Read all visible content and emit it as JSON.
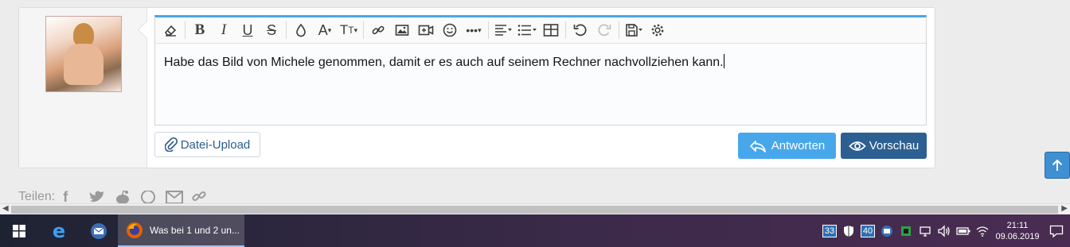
{
  "editor": {
    "text": "Habe das Bild von Michele genommen, damit er es auch auf seinem Rechner nachvollziehen kann."
  },
  "toolbar": {
    "buttons": [
      "eraser-icon",
      "bold-icon",
      "italic-icon",
      "underline-icon",
      "strikethrough-icon",
      "text-color-icon",
      "font-family-icon",
      "font-size-icon",
      "link-icon",
      "image-icon",
      "media-icon",
      "emoji-icon",
      "more-icon",
      "align-icon",
      "list-icon",
      "table-icon",
      "undo-icon",
      "redo-icon",
      "drafts-icon",
      "settings-icon"
    ]
  },
  "actions": {
    "upload_label": "Datei-Upload",
    "reply_label": "Antworten",
    "preview_label": "Vorschau"
  },
  "share": {
    "label": "Teilen:"
  },
  "taskbar": {
    "active_task": "Was bei 1 und 2 un...",
    "tray_num1": "33",
    "tray_num2": "40",
    "time": "21:11",
    "date": "09.06.2019"
  },
  "colors": {
    "reply_button": "#47a7eb",
    "preview_button": "#2c5f92",
    "editor_accent": "#47a7eb"
  }
}
